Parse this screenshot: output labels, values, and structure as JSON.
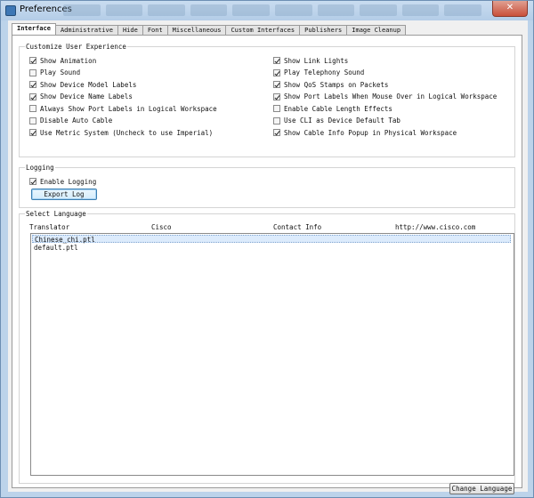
{
  "window": {
    "title": "Preferences",
    "close_label": "✕"
  },
  "tabs": [
    {
      "label": "Interface",
      "active": true
    },
    {
      "label": "Administrative",
      "active": false
    },
    {
      "label": "Hide",
      "active": false
    },
    {
      "label": "Font",
      "active": false
    },
    {
      "label": "Miscellaneous",
      "active": false
    },
    {
      "label": "Custom Interfaces",
      "active": false
    },
    {
      "label": "Publishers",
      "active": false
    },
    {
      "label": "Image Cleanup",
      "active": false
    }
  ],
  "customize": {
    "legend": "Customize User Experience",
    "left": [
      {
        "label": "Show Animation",
        "checked": true
      },
      {
        "label": "Play Sound",
        "checked": false
      },
      {
        "label": "Show Device Model Labels",
        "checked": true
      },
      {
        "label": "Show Device Name Labels",
        "checked": true
      },
      {
        "label": "Always Show Port Labels in Logical Workspace",
        "checked": false
      },
      {
        "label": "Disable Auto Cable",
        "checked": false
      },
      {
        "label": "Use Metric System (Uncheck to use Imperial)",
        "checked": true
      }
    ],
    "right": [
      {
        "label": "Show Link Lights",
        "checked": true
      },
      {
        "label": "Play Telephony Sound",
        "checked": true
      },
      {
        "label": "Show QoS Stamps on Packets",
        "checked": true
      },
      {
        "label": "Show Port Labels When Mouse Over in Logical Workspace",
        "checked": true
      },
      {
        "label": "Enable Cable Length Effects",
        "checked": false
      },
      {
        "label": "Use CLI as Device Default Tab",
        "checked": false
      },
      {
        "label": "Show Cable Info Popup in Physical Workspace",
        "checked": true
      }
    ]
  },
  "logging": {
    "legend": "Logging",
    "enable_label": "Enable Logging",
    "enabled": true,
    "export_label": "Export Log"
  },
  "language": {
    "legend": "Select Language",
    "headers": {
      "translator": "Translator",
      "publisher": "Cisco",
      "contact": "Contact Info",
      "url": "http://www.cisco.com"
    },
    "items": [
      {
        "label": "Chinese_chi.ptl",
        "selected": true
      },
      {
        "label": "default.ptl",
        "selected": false
      }
    ],
    "change_label": "Change Language"
  }
}
